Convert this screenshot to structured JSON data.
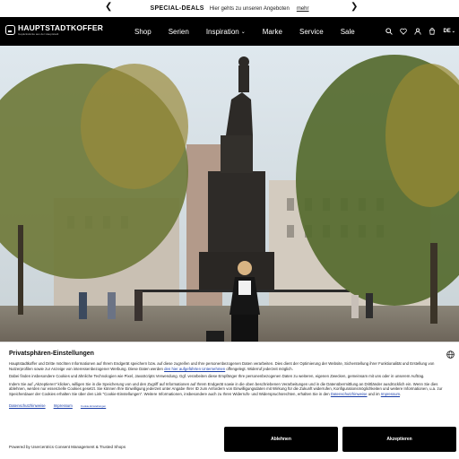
{
  "promo": {
    "title": "SPECIAL-DEALS",
    "subtitle": "Hier gehts zu unseren Angeboten",
    "more": "mehr"
  },
  "brand": {
    "name": "HAUPTSTADTKOFFER",
    "tagline": "Gepäckstücke aus der Hauptstadt"
  },
  "nav": {
    "items": [
      {
        "label": "Shop"
      },
      {
        "label": "Serien"
      },
      {
        "label": "Inspiration"
      },
      {
        "label": "Marke"
      },
      {
        "label": "Service"
      },
      {
        "label": "Sale"
      }
    ],
    "language": "DE"
  },
  "consent": {
    "title": "Privatsphären-Einstellungen",
    "para1": "Hauptstadtkoffer und Dritte möchten Informationen auf Ihrem Endgerät speichern bzw. auf diese zugreifen und Ihre personenbezogenen Daten verarbeiten. Dies dient der Optimierung der Website, Sicherstellung ihrer Funktionalität und Erstellung von Nutzerprofilen sowie zur Anzeige von interessenbezogener Werbung. Diese Daten werden",
    "para1_link": "den hier aufgeführten Unternehmen",
    "para1_end": "offengelegt. Widerruf jederzeit möglich.",
    "para2": "Dabei finden insbesondere Cookies und ähnliche Technologien wie Pixel, JavaScripts Verwendung. Ggf. verarbeiten diese Empfänger Ihre personenbezogenen Daten zu weiteren, eigenen Zwecken, gemeinsam mit uns oder in unserem Auftrag.",
    "para3": "Indem Sie auf „Akzeptieren\" klicken, willigen Sie in die Speicherung von und den Zugriff auf Informationen auf Ihrem Endgerät sowie in die oben beschriebenen Verarbeitungen und in die Datenübermittlung an Drittländer ausdrücklich ein. Wenn Sie dies ablehnen, werden nur essenzielle Cookies gesetzt. Sie können Ihre Einwilligung jederzeit unter Angabe Ihrer ID zum Anfordern von Einwilligungsdaten mit Wirkung für die Zukunft widerrufen, Konfigurationsmöglichkeiten und weitere Informationen, u.a. zur Speicherdauer der Cookies erhalten Sie über den Link \"Cookie-Einstellungen\". Weitere Informationen, insbesondere auch zu Ihren Widerrufs- und Widerspruchsrechten, erhalten Sie in den",
    "para3_link1": "Datenschutzhinweise",
    "para3_and": "und im",
    "para3_link2": "Impressum",
    "link_privacy": "Datenschutzhinweise",
    "link_imprint": "Impressum",
    "link_settings": "Cookie-Einstellungen",
    "powered": "Powered by Usercentrics Consent Management & Trusted Shops",
    "reject_label": "Ablehnen",
    "accept_label": "Akzeptieren"
  }
}
